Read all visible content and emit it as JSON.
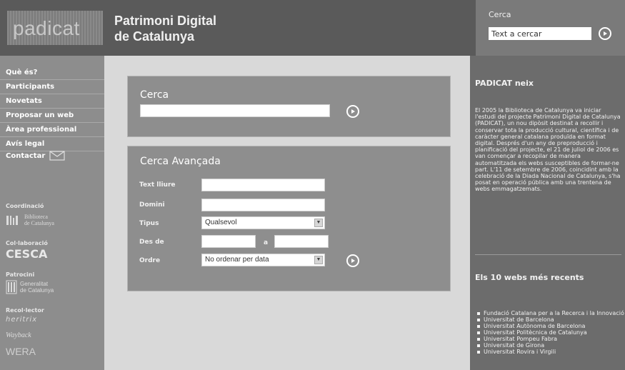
{
  "header": {
    "logo_text": "padicat",
    "title_line1": "Patrimoni Digital",
    "title_line2": "de Catalunya",
    "search_label": "Cerca",
    "search_value": "Text a cercar"
  },
  "sidebar": {
    "nav": [
      "Què és?",
      "Participants",
      "Novetats",
      "Proposar un web",
      "Àrea professional",
      "Avís legal"
    ],
    "contact": "Contactar",
    "coordinacio": "Coordinació",
    "coord_logo_line1": "Biblioteca",
    "coord_logo_line2": "de Catalunya",
    "col_laboracio": "Col·laboració",
    "cesca": "CESCA",
    "patrocini": "Patrocini",
    "patr_logo_line1": "Generalitat",
    "patr_logo_line2": "de Catalunya",
    "recol_lector": "Recol·lector",
    "rec_logo1": "heritrix",
    "rec_logo2": "Wayback",
    "rec_logo3": "WERA"
  },
  "search": {
    "title": "Cerca",
    "value": ""
  },
  "advanced": {
    "title": "Cerca Avançada",
    "text_label": "Text lliure",
    "domain_label": "Domini",
    "type_label": "Tipus",
    "type_value": "Qualsevol",
    "from_label": "Des de",
    "to_label": "a",
    "order_label": "Ordre",
    "order_value": "No ordenar per data"
  },
  "right": {
    "news_title": "PADICAT neix",
    "news_body": "El 2005 la Biblioteca de Catalunya va iniciar l'estudi del projecte Patrimoni Digital de Catalunya (PADICAT), un nou dipòsit destinat a recollir i conservar tota la producció cultural, científica i de caràcter general catalana produïda en format digital. Després d'un any de preproducció i planificació del projecte, el 21 de juliol de 2006 es van començar a recopilar de manera automatitzada els webs susceptibles de formar-ne part. L'11 de setembre de 2006, coincidint amb la celebració de la Diada Nacional de Catalunya, s'ha posat en operació pública amb una trentena de webs emmagatzemats.",
    "recent_title": "Els 10 webs més recents",
    "recent": [
      "Fundació Catalana per a la Recerca i la Innovació",
      "Universitat de Barcelona",
      "Universitat Autònoma de Barcelona",
      "Universitat Politècnica de Catalunya",
      "Universitat Pompeu Fabra",
      "Universitat de Girona",
      "Universitat Rovira i Virgili"
    ]
  }
}
